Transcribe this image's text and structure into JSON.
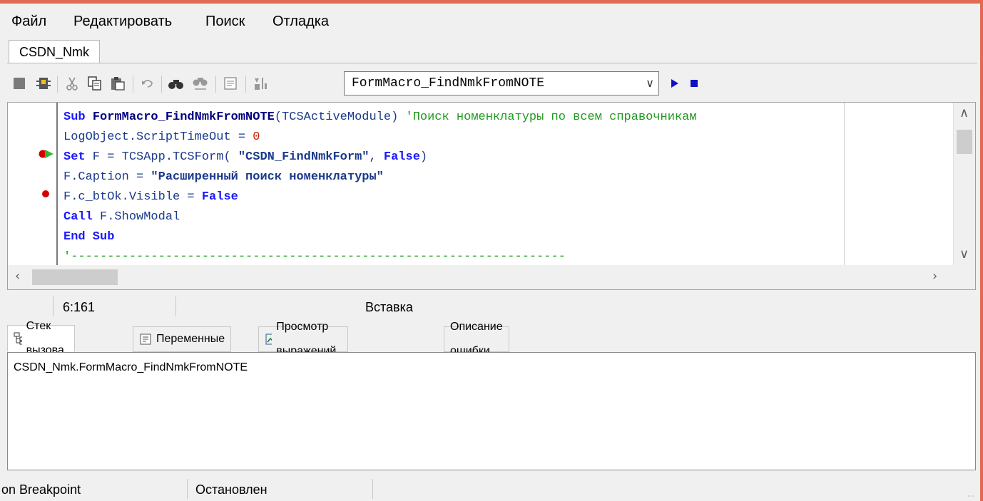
{
  "menu": {
    "items": [
      "Файл",
      "Редактировать",
      "Поиск",
      "Отладка"
    ]
  },
  "document_tab": {
    "label": "CSDN_Nmk"
  },
  "toolbar": {
    "procedure_combo_value": "FormMacro_FindNmkFromNOTE",
    "icons": [
      "stop-square-icon",
      "debug-bug-icon",
      "cut-icon",
      "copy-icon",
      "paste-icon",
      "undo-icon",
      "find-icon",
      "find-replace-icon",
      "properties-icon",
      "sort-icon",
      "run-icon",
      "stop-icon"
    ]
  },
  "code": {
    "lines": [
      {
        "parts": [
          {
            "t": "Sub ",
            "c": "kw"
          },
          {
            "t": "FormMacro_FindNmkFromNOTE",
            "c": "fn"
          },
          {
            "t": "(TCSActiveModule) ",
            "c": "plain"
          },
          {
            "t": "'Поиск номенклатуры по всем справочникам",
            "c": "cmt"
          }
        ]
      },
      {
        "parts": [
          {
            "t": "LogObject.ScriptTimeOut = ",
            "c": "plain"
          },
          {
            "t": "0",
            "c": "num"
          }
        ]
      },
      {
        "marker": "current",
        "parts": [
          {
            "t": "Set",
            "c": "kw"
          },
          {
            "t": " F = TCSApp.TCSForm( ",
            "c": "plain"
          },
          {
            "t": "\"CSDN_FindNmkForm\"",
            "c": "str"
          },
          {
            "t": ", ",
            "c": "plain"
          },
          {
            "t": "False",
            "c": "kw"
          },
          {
            "t": ")",
            "c": "plain"
          }
        ]
      },
      {
        "parts": [
          {
            "t": "F.Caption = ",
            "c": "plain"
          },
          {
            "t": "\"Расширенный поиск номенклатуры\"",
            "c": "str"
          }
        ]
      },
      {
        "marker": "breakpoint",
        "parts": [
          {
            "t": "F.c_btOk.Visible = ",
            "c": "plain"
          },
          {
            "t": "False",
            "c": "kw"
          }
        ]
      },
      {
        "parts": [
          {
            "t": "Call",
            "c": "kw"
          },
          {
            "t": " F.ShowModal",
            "c": "plain"
          }
        ]
      },
      {
        "parts": [
          {
            "t": "End Sub",
            "c": "kw"
          }
        ]
      },
      {
        "parts": [
          {
            "t": "'--------------------------------------------------------------------",
            "c": "dash"
          }
        ]
      }
    ]
  },
  "editor_status": {
    "position": "6:161",
    "mode": "Вставка"
  },
  "bottom_tabs": [
    {
      "label": "Стек вызова",
      "icon": "call-stack-icon",
      "active": true
    },
    {
      "label": "Переменные",
      "icon": "variables-icon",
      "active": false
    },
    {
      "label": "Просмотр выражений",
      "icon": "watch-icon",
      "active": false
    },
    {
      "label": "Описание ошибки",
      "icon": "",
      "active": false
    }
  ],
  "call_stack": {
    "rows": [
      "CSDN_Nmk.FormMacro_FindNmkFromNOTE"
    ]
  },
  "bottom_status": {
    "reason": "on Breakpoint",
    "state": "Остановлен"
  },
  "colors": {
    "window_border": "#e06b52",
    "keyword": "#1a1aff",
    "comment": "#1f9a1f",
    "breakpoint": "#d40000",
    "number": "#cc2200"
  }
}
